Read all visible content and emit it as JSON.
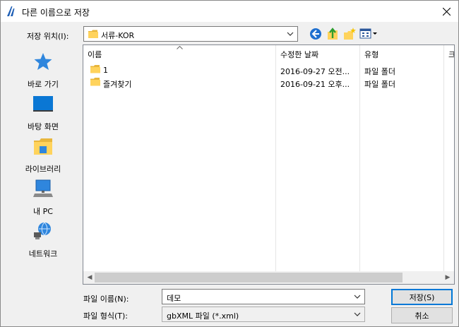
{
  "window": {
    "title": "다른 이름으로 저장"
  },
  "location": {
    "label": "저장 위치(I):",
    "value": "서류-KOR"
  },
  "places": [
    {
      "label": "바로 가기"
    },
    {
      "label": "바탕 화면"
    },
    {
      "label": "라이브러리"
    },
    {
      "label": "내 PC"
    },
    {
      "label": "네트워크"
    }
  ],
  "columns": {
    "name": "이름",
    "modified": "수정한 날짜",
    "type": "유형",
    "size": "크"
  },
  "files": [
    {
      "name": "1",
      "modified": "2016-09-27 오전...",
      "type": "파일 폴더"
    },
    {
      "name": "즐겨찾기",
      "modified": "2016-09-21 오후...",
      "type": "파일 폴더"
    }
  ],
  "filename": {
    "label": "파일 이름(N):",
    "value": "데모"
  },
  "filetype": {
    "label": "파일 형식(T):",
    "value": "gbXML 파일 (*.xml)"
  },
  "buttons": {
    "save": "저장(S)",
    "cancel": "취소"
  },
  "colors": {
    "accent": "#0078d7",
    "folder": "#ffd35c"
  }
}
